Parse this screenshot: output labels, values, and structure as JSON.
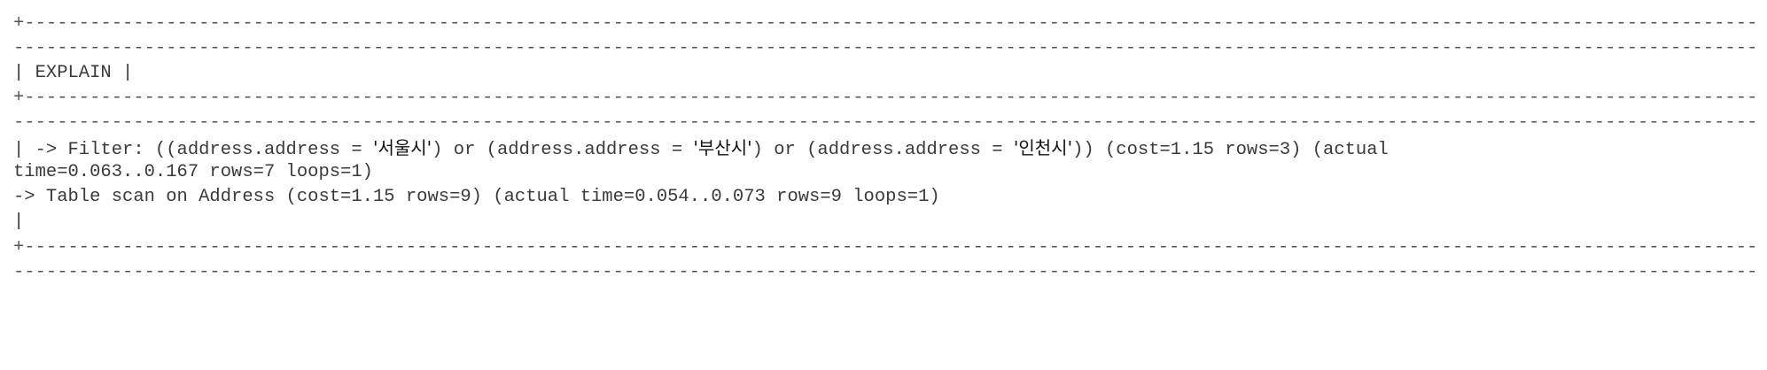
{
  "output": {
    "border_top_1": "+--------------------------------------------------------------------------------------------------------------------------------------------------------------------------",
    "border_top_2": "--------------------------------------------------------------------------------------------------------------------------------------------------------------------------+",
    "header": "| EXPLAIN |",
    "border_mid_1": "+--------------------------------------------------------------------------------------------------------------------------------------------------------------------------",
    "border_mid_2": "--------------------------------------------------------------------------------------------------------------------------------------------------------------------------+",
    "row": {
      "line1_prefix": "| -> Filter: ((address.address = ",
      "value_seoul": "'서울시'",
      "line1_mid1": ") or (address.address = ",
      "value_busan": "'부산시'",
      "line1_mid2": ") or (address.address = ",
      "value_incheon": "'인천시'",
      "line1_suffix": ")) (cost=1.15 rows=3) (actual",
      "line2": "time=0.063..0.167 rows=7 loops=1)",
      "line3": "-> Table scan on Address (cost=1.15 rows=9) (actual time=0.054..0.073 rows=9 loops=1)",
      "line4": "|"
    },
    "border_bottom_1": "+--------------------------------------------------------------------------------------------------------------------------------------------------------------------------",
    "border_bottom_2": "--------------------------------------------------------------------------------------------------------------------------------------------------------------------------+"
  }
}
